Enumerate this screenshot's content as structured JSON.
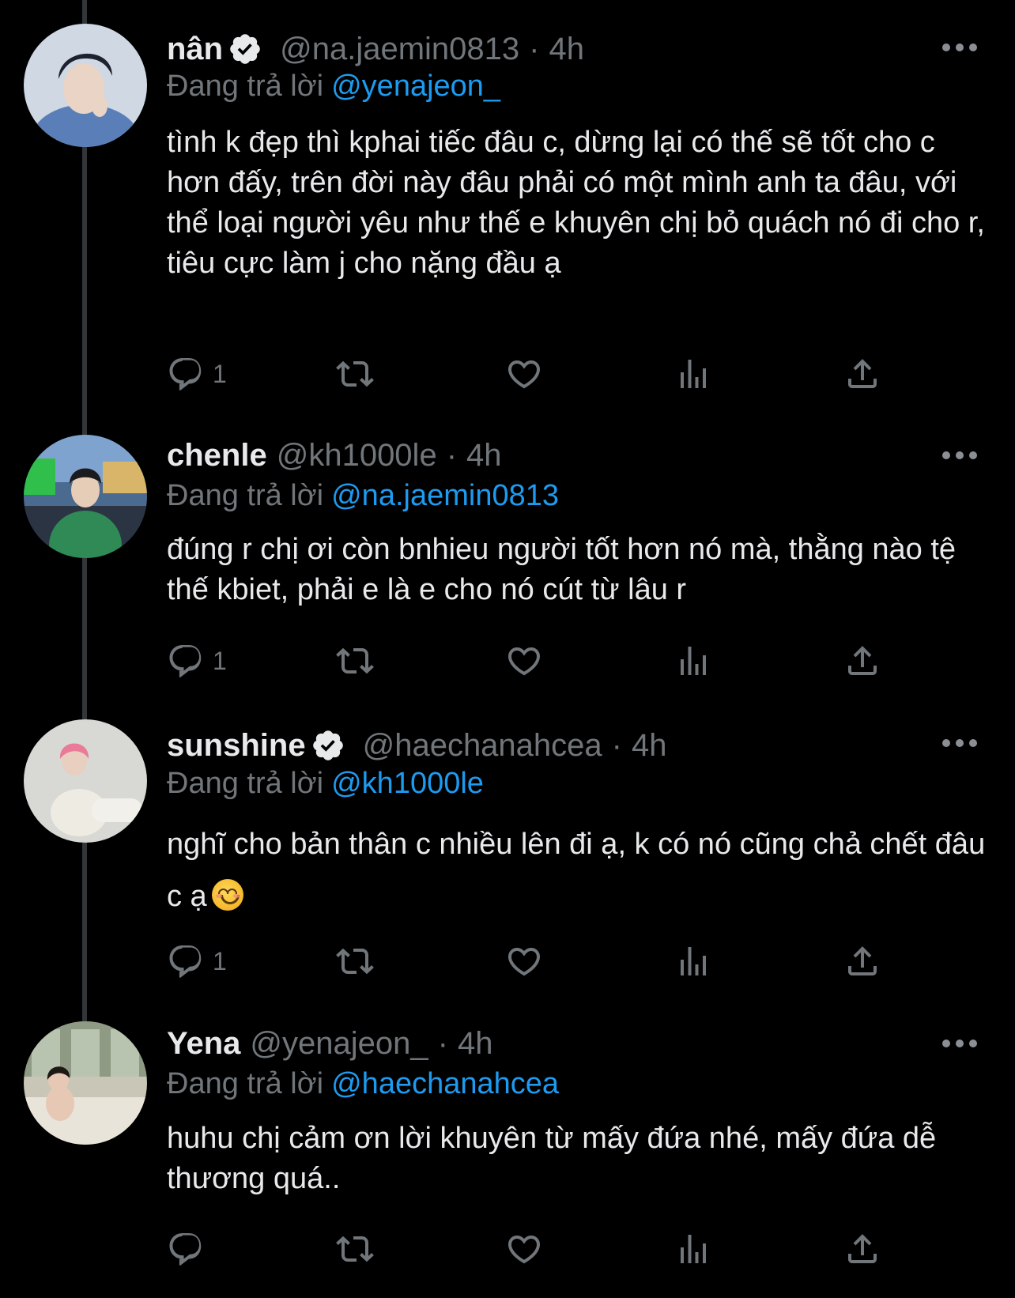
{
  "reply_prefix": "Đang trả lời",
  "tweets": [
    {
      "name": "nân",
      "verified": true,
      "handle": "@na.jaemin0813",
      "sep": "·",
      "time": "4h",
      "reply_to": "@yenajeon_",
      "text": "tình k đẹp thì kphai tiếc đâu c, dừng lại có thế sẽ tốt cho c hơn đấy, trên đời này đâu phải có một mình anh ta đâu, với thể loại người yêu như thế e khuyên chị bỏ quách nó đi cho r, tiêu cực làm j cho nặng đầu ạ",
      "reply_count": "1"
    },
    {
      "name": "chenle",
      "verified": false,
      "handle": "@kh1000le",
      "sep": "·",
      "time": "4h",
      "reply_to": "@na.jaemin0813",
      "text": "đúng r chị ơi còn bnhieu người tốt hơn nó mà, thằng nào tệ thế kbiet, phải e là e cho nó cút từ lâu r",
      "reply_count": "1"
    },
    {
      "name": "sunshine",
      "verified": true,
      "handle": "@haechanahcea",
      "sep": "·",
      "time": "4h",
      "reply_to": "@kh1000le",
      "text": "nghĩ cho bản thân c nhiều lên đi ạ, k có nó cũng chả chết đâu c ạ",
      "emoji": "smiling-face-emoji",
      "reply_count": "1"
    },
    {
      "name": "Yena",
      "verified": false,
      "handle": "@yenajeon_",
      "sep": "·",
      "time": "4h",
      "reply_to": "@haechanahcea",
      "text": "huhu chị cảm ơn lời khuyên từ mấy đứa nhé, mấy đứa dễ thương quá..",
      "reply_count": ""
    }
  ],
  "icons": [
    "more-icon",
    "reply-icon",
    "retweet-icon",
    "like-icon",
    "views-icon",
    "share-icon",
    "verified-badge-icon"
  ],
  "colors": {
    "background": "#000000",
    "text": "#e7e9ea",
    "secondary": "#71767b",
    "link": "#1d9bf0"
  }
}
